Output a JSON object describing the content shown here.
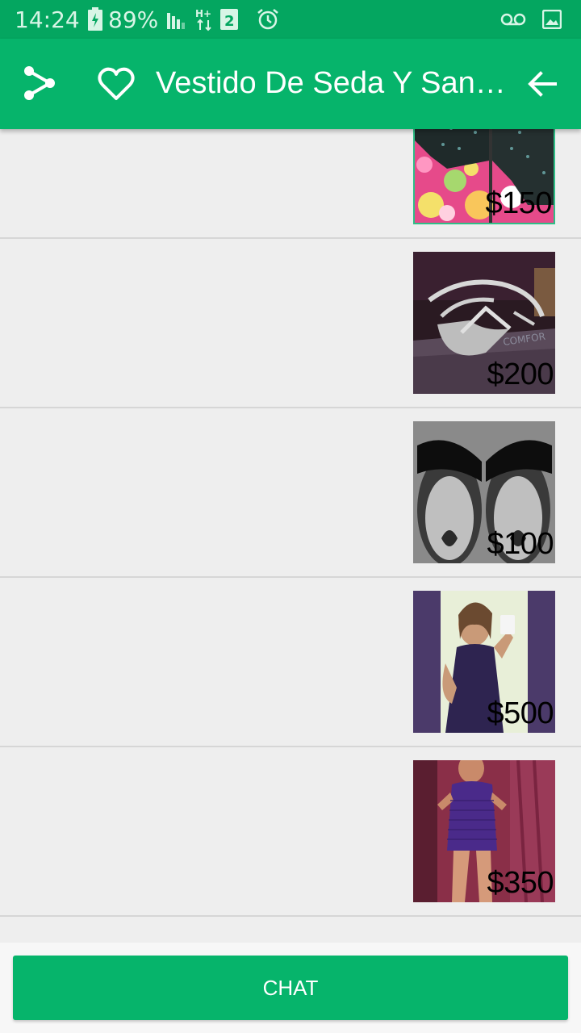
{
  "status_bar": {
    "time": "14:24",
    "battery": "89%",
    "icons": [
      "battery-charging-icon",
      "signal-icon",
      "hplus-data-icon",
      "sim-2-icon",
      "alarm-icon",
      "voicemail-icon",
      "gallery-icon"
    ]
  },
  "app_bar": {
    "title": "Vestido De Seda Y Sandalias",
    "icons": [
      "share-icon",
      "heart-icon",
      "back-arrow-icon"
    ],
    "color": "#06b46b"
  },
  "items": [
    {
      "price": "$150",
      "image": "black-studded-heels"
    },
    {
      "price": "$200",
      "image": "silver-strappy-sandals"
    },
    {
      "price": "$100",
      "image": "black-sparkle-sandals"
    },
    {
      "price": "$500",
      "image": "navy-dress-selfie"
    },
    {
      "price": "$350",
      "image": "purple-dress-photo"
    }
  ],
  "bottom_bar": {
    "chat_label": "CHAT"
  },
  "colors": {
    "accent": "#06b46b",
    "status_bar": "#04a660",
    "background": "#eeeeee"
  }
}
